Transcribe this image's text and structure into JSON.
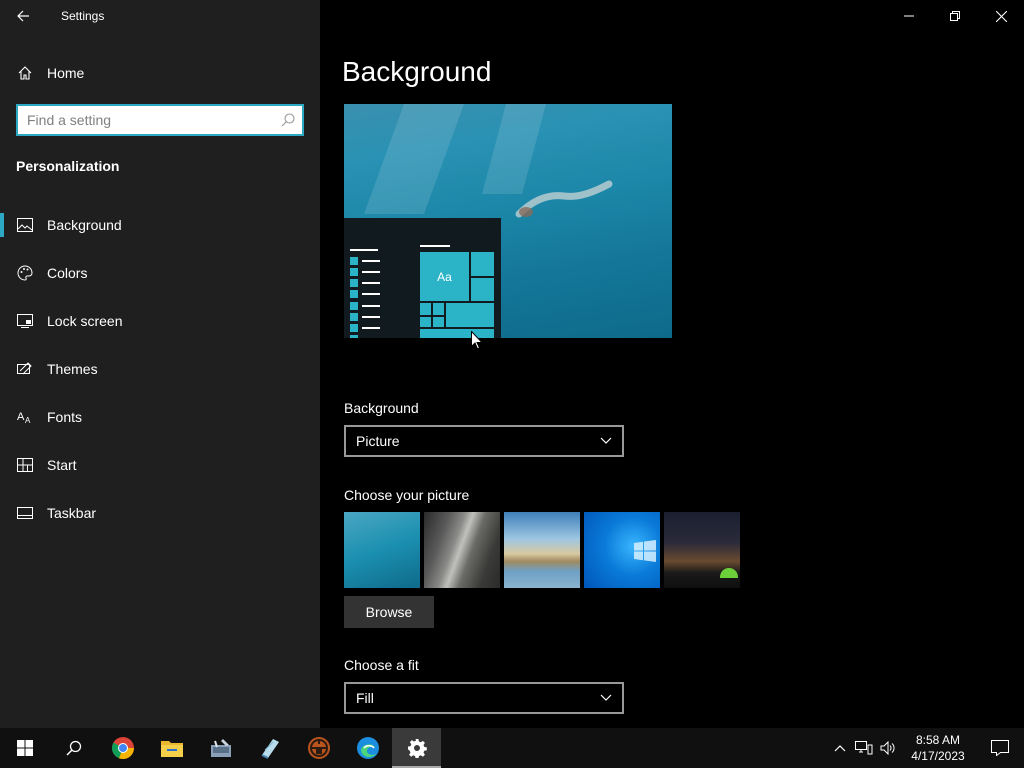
{
  "window": {
    "title": "Settings",
    "controls": [
      "minimize-icon",
      "restore-icon",
      "close-icon"
    ]
  },
  "sidebar": {
    "home_label": "Home",
    "search": {
      "placeholder": "Find a setting",
      "value": ""
    },
    "section_title": "Personalization",
    "items": [
      {
        "label": "Background",
        "icon": "picture-icon",
        "active": true
      },
      {
        "label": "Colors",
        "icon": "palette-icon",
        "active": false
      },
      {
        "label": "Lock screen",
        "icon": "lock-screen-icon",
        "active": false
      },
      {
        "label": "Themes",
        "icon": "themes-icon",
        "active": false
      },
      {
        "label": "Fonts",
        "icon": "fonts-icon",
        "active": false
      },
      {
        "label": "Start",
        "icon": "start-icon",
        "active": false
      },
      {
        "label": "Taskbar",
        "icon": "taskbar-icon",
        "active": false
      }
    ]
  },
  "main": {
    "page_title": "Background",
    "preview": {
      "tile_text": "Aa"
    },
    "background_label": "Background",
    "background_value": "Picture",
    "choose_picture_label": "Choose your picture",
    "thumbnails": [
      "underwater",
      "rock-wall",
      "beach-rocks",
      "windows-logo",
      "night-sky-tent"
    ],
    "browse_label": "Browse",
    "fit_label": "Choose a fit",
    "fit_value": "Fill"
  },
  "taskbar": {
    "apps": [
      "start-icon",
      "search-icon",
      "chrome-icon",
      "file-explorer-icon",
      "tool-app-icon",
      "notepad-app-icon",
      "game-app-icon",
      "edge-icon",
      "settings-icon"
    ],
    "active_app": "settings-icon",
    "tray": [
      "chevron-up-icon",
      "network-icon",
      "volume-icon"
    ],
    "time": "8:58 AM",
    "date": "4/17/2023"
  },
  "colors": {
    "accent": "#2da8c4",
    "sidebar_bg": "#1f1f1f",
    "main_bg": "#000000",
    "taskbar_bg": "#101010"
  }
}
